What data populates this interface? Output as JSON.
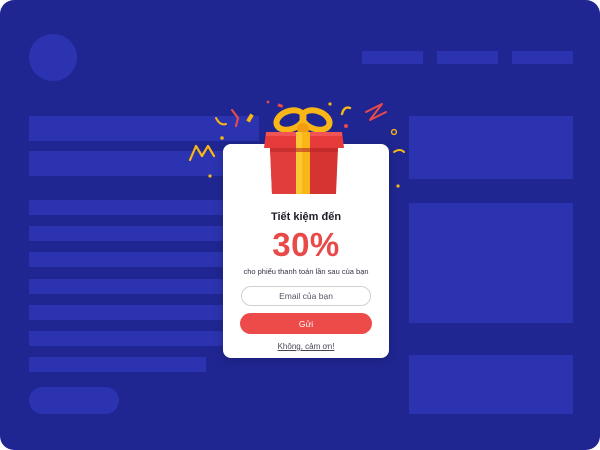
{
  "popup": {
    "title": "Tiết kiệm đến",
    "discount": "30%",
    "subtitle": "cho phiếu thanh toán lần sau của bạn",
    "email_placeholder": "Email của bạn",
    "submit_label": "Gửi",
    "dismiss_label": "Không, cảm ơn!"
  },
  "colors": {
    "background": "#1f2691",
    "placeholder_block": "#2b33b0",
    "accent_red": "#ed4a4a",
    "gift_ribbon": "#f8b617"
  },
  "icons": {
    "gift": "gift-box-icon",
    "confetti": "confetti-icon"
  }
}
